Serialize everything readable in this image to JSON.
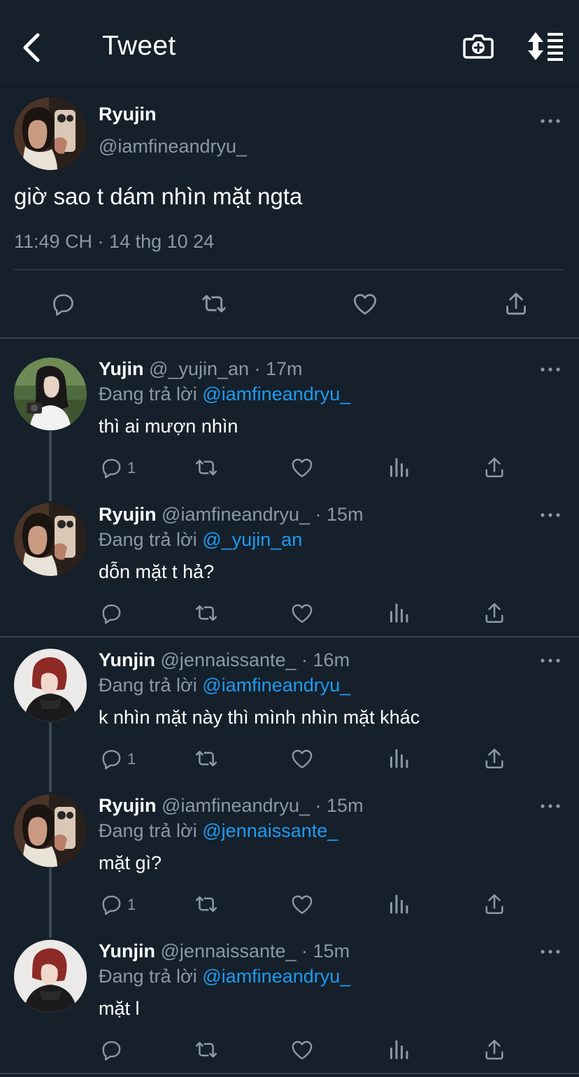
{
  "header": {
    "title": "Tweet"
  },
  "main_tweet": {
    "name": "Ryujin",
    "handle": "@iamfineandryu_",
    "text": "giờ sao t dám nhìn mặt ngta",
    "timestamp": "11:49 CH · 14 thg 10 24"
  },
  "replies": [
    {
      "name": "Yujin",
      "meta": "@_yujin_an · 17m",
      "reply_prefix": "Đang trả lời ",
      "reply_to": "@iamfineandryu_",
      "text": "thì ai mượn nhìn",
      "reply_count": "1"
    },
    {
      "name": "Ryujin",
      "meta": "@iamfineandryu_ · 15m",
      "reply_prefix": "Đang trả lời ",
      "reply_to": "@_yujin_an",
      "text": "dỗn mặt t hả?",
      "reply_count": ""
    },
    {
      "name": "Yunjin",
      "meta": "@jennaissante_ · 16m",
      "reply_prefix": "Đang trả lời ",
      "reply_to": "@iamfineandryu_",
      "text": "k nhìn mặt này thì mình nhìn mặt khác",
      "reply_count": "1"
    },
    {
      "name": "Ryujin",
      "meta": "@iamfineandryu_ · 15m",
      "reply_prefix": "Đang trả lời ",
      "reply_to": "@jennaissante_",
      "text": "mặt gì?",
      "reply_count": "1"
    },
    {
      "name": "Yunjin",
      "meta": "@jennaissante_ · 15m",
      "reply_prefix": "Đang trả lời ",
      "reply_to": "@iamfineandryu_",
      "text": "mặt l",
      "reply_count": ""
    }
  ],
  "icons": {
    "back": "chevron-left-icon",
    "camera": "camera-plus-icon",
    "sort": "sort-icon",
    "reply": "reply-icon",
    "retweet": "retweet-icon",
    "like": "heart-icon",
    "views": "views-icon",
    "share": "share-icon",
    "more": "more-icon"
  },
  "colors": {
    "background": "#15202b",
    "text": "#ffffff",
    "secondary": "#8b98a5",
    "mention": "#1d9bf0",
    "divider": "#38444d"
  }
}
